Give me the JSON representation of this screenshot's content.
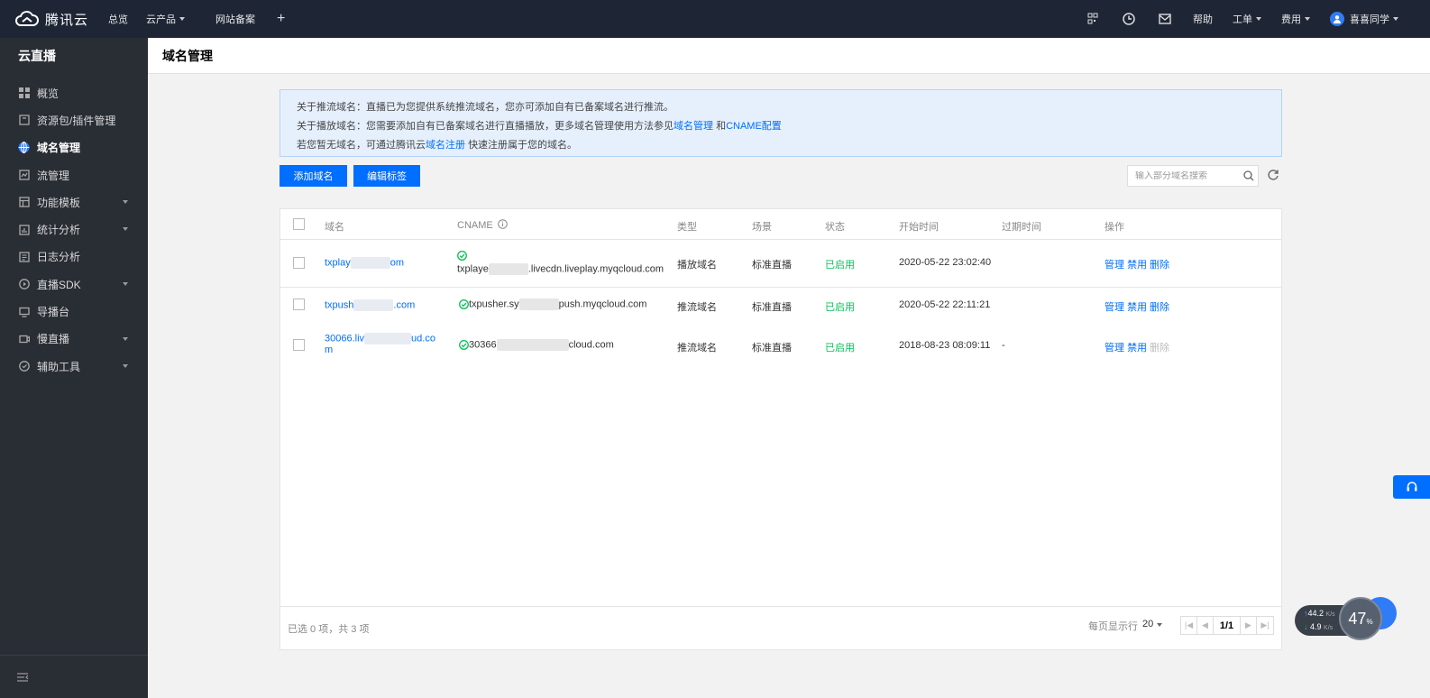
{
  "topbar": {
    "brand": "腾讯云",
    "nav": [
      "总览",
      "云产品",
      "网站备案"
    ],
    "right": {
      "help": "帮助",
      "ticket": "工单",
      "billing": "费用",
      "user": "喜喜同学"
    }
  },
  "sidebar": {
    "title": "云直播",
    "items": [
      {
        "label": "概览",
        "icon": "grid-icon"
      },
      {
        "label": "资源包/插件管理",
        "icon": "package-icon"
      },
      {
        "label": "域名管理",
        "icon": "globe-icon",
        "active": true
      },
      {
        "label": "流管理",
        "icon": "stream-icon"
      },
      {
        "label": "功能模板",
        "icon": "template-icon",
        "expandable": true
      },
      {
        "label": "统计分析",
        "icon": "stats-icon",
        "expandable": true
      },
      {
        "label": "日志分析",
        "icon": "log-icon"
      },
      {
        "label": "直播SDK",
        "icon": "play-icon",
        "expandable": true
      },
      {
        "label": "导播台",
        "icon": "monitor-icon"
      },
      {
        "label": "慢直播",
        "icon": "camera-icon",
        "expandable": true
      },
      {
        "label": "辅助工具",
        "icon": "tool-icon",
        "expandable": true
      }
    ]
  },
  "page": {
    "title": "域名管理"
  },
  "notice": {
    "line1": "关于推流域名：直播已为您提供系统推流域名，您亦可添加自有已备案域名进行推流。",
    "line2_prefix": "关于播放域名：您需要添加自有已备案域名进行直播播放，更多域名管理使用方法参见",
    "line2_link1": "域名管理",
    "line2_and": "和",
    "line2_link2": "CNAME配置",
    "line3_prefix": "若您暂无域名，可通过腾讯云",
    "line3_link": "域名注册",
    "line3_suffix": "快速注册属于您的域名。"
  },
  "toolbar": {
    "add_domain": "添加域名",
    "edit_tags": "编辑标签",
    "search_placeholder": "输入部分域名搜索"
  },
  "table": {
    "headers": {
      "domain": "域名",
      "cname": "CNAME",
      "type": "类型",
      "scene": "场景",
      "status": "状态",
      "start_time": "开始时间",
      "expire_time": "过期时间",
      "actions": "操作"
    },
    "rows": [
      {
        "domain_prefix": "txplay",
        "domain_suffix": "om",
        "cname_prefix": "txplaye",
        "cname_suffix": ".livecdn.liveplay.myqcloud.com",
        "type": "播放域名",
        "scene": "标准直播",
        "status": "已启用",
        "start_time": "2020-05-22 23:02:40",
        "expire_time": "",
        "actions": [
          "管理",
          "禁用",
          "删除"
        ]
      },
      {
        "domain_prefix": "txpush",
        "domain_suffix": ".com",
        "cname_prefix": "txpusher.sy",
        "cname_suffix": "push.myqcloud.com",
        "type": "推流域名",
        "scene": "标准直播",
        "status": "已启用",
        "start_time": "2020-05-22 22:11:21",
        "expire_time": "",
        "actions": [
          "管理",
          "禁用",
          "删除"
        ]
      },
      {
        "domain_prefix": "30066.liv",
        "domain_suffix": "ud.co",
        "domain_line2": "m",
        "cname_prefix": "30366",
        "cname_suffix": "cloud.com",
        "type": "推流域名",
        "scene": "标准直播",
        "status": "已启用",
        "start_time": "2018-08-23 08:09:11",
        "expire_time": "-",
        "actions": [
          "管理",
          "禁用",
          "删除"
        ]
      }
    ]
  },
  "footer": {
    "selection": "已选 0 项，共 3 项",
    "per_page_label": "每页显示行",
    "per_page": "20",
    "page": "1/1"
  },
  "widgets": {
    "up_speed": "44.2",
    "down_speed": "4.9",
    "speed_unit": "K/s",
    "gauge": "47",
    "gauge_unit": "%"
  },
  "colors": {
    "primary": "#006eff",
    "topbar": "#1e2636",
    "sidebar": "#292d34",
    "success": "#0abf5b"
  }
}
